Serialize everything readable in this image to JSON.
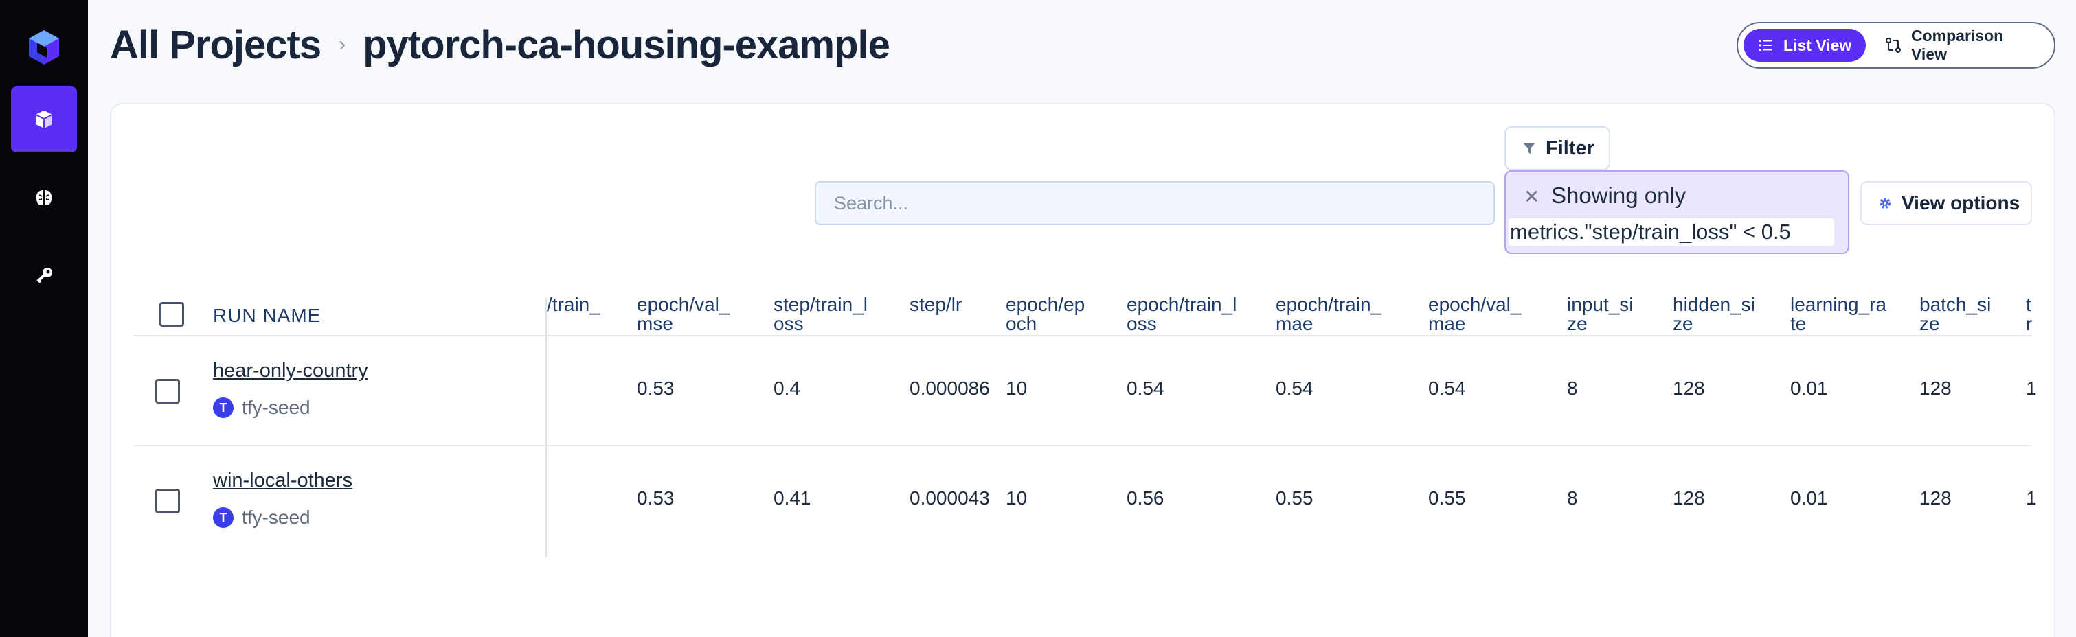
{
  "header": {
    "crumb_root": "All Projects",
    "crumb_sep": "›",
    "project_name": "pytorch-ca-housing-example"
  },
  "view_toggle": {
    "list_label": "List View",
    "comparison_label": "Comparison View"
  },
  "toolbar": {
    "search_placeholder": "Search...",
    "filter_label": "Filter",
    "filter_chip_title": "Showing only",
    "filter_chip_expression": "metrics.\"step/train_loss\" < 0.5",
    "view_options_label": "View options"
  },
  "table": {
    "run_name_header": "RUN NAME",
    "partial_header": "/train_",
    "columns": [
      {
        "label": "epoch/val_\nmse"
      },
      {
        "label": "step/train_l\noss"
      },
      {
        "label": "step/lr"
      },
      {
        "label": "epoch/ep\noch"
      },
      {
        "label": "epoch/train_l\noss"
      },
      {
        "label": "epoch/train_\nmae"
      },
      {
        "label": "epoch/val_\nmae"
      },
      {
        "label": "input_si\nze"
      },
      {
        "label": "hidden_si\nze"
      },
      {
        "label": "learning_ra\nte"
      },
      {
        "label": "batch_si\nze"
      },
      {
        "label": "t\nr"
      }
    ],
    "rows": [
      {
        "name": "hear-only-country",
        "tag_initial": "T",
        "tag": "tfy-seed",
        "values": [
          "0.53",
          "0.4",
          "0.000086",
          "10",
          "0.54",
          "0.54",
          "0.54",
          "8",
          "128",
          "0.01",
          "128",
          "1"
        ]
      },
      {
        "name": "win-local-others",
        "tag_initial": "T",
        "tag": "tfy-seed",
        "values": [
          "0.53",
          "0.41",
          "0.000043",
          "10",
          "0.56",
          "0.55",
          "0.55",
          "8",
          "128",
          "0.01",
          "128",
          "1"
        ]
      }
    ]
  }
}
